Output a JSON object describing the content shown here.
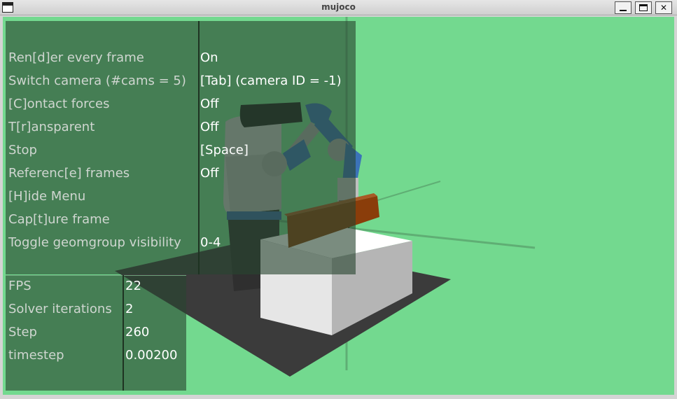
{
  "window": {
    "title": "mujoco"
  },
  "menu": [
    {
      "label": "Ren[d]er every frame",
      "value": "On"
    },
    {
      "label": "Switch camera (#cams = 5)",
      "value": "[Tab] (camera ID = -1)"
    },
    {
      "label": "[C]ontact forces",
      "value": "Off"
    },
    {
      "label": "T[r]ansparent",
      "value": "Off"
    },
    {
      "label": "Stop",
      "value": "[Space]"
    },
    {
      "label": "Referenc[e] frames",
      "value": "Off"
    },
    {
      "label": "[H]ide Menu",
      "value": ""
    },
    {
      "label": "Cap[t]ure frame",
      "value": ""
    },
    {
      "label": "Toggle geomgroup visibility",
      "value": "0-4"
    }
  ],
  "info": [
    {
      "label": "FPS",
      "value": "22"
    },
    {
      "label": "Solver iterations",
      "value": "2"
    },
    {
      "label": "Step",
      "value": "260"
    },
    {
      "label": "timestep",
      "value": "0.00200"
    }
  ],
  "colors": {
    "background": "#73d98f",
    "table": "#3a3a3a",
    "robot_body": "#c9c9c9",
    "robot_link_blue": "#3b73b8",
    "object": "#8a3d0a"
  }
}
